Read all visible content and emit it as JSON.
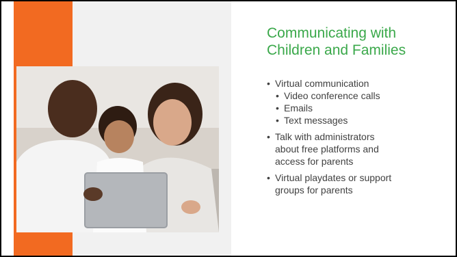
{
  "slide": {
    "title_lines": [
      "Communicating with",
      "Children and Families"
    ],
    "bullets": [
      "Virtual communication",
      "Video conference calls",
      "Emails",
      "Text messages",
      "Talk with administrators",
      "about free platforms and",
      "access for parents",
      "Virtual playdates or support",
      "groups for parents"
    ],
    "photo_icon": "family-laptop-photo",
    "colors": {
      "accent": "#f26a21",
      "title": "#3aa84a",
      "text": "#404040"
    }
  }
}
